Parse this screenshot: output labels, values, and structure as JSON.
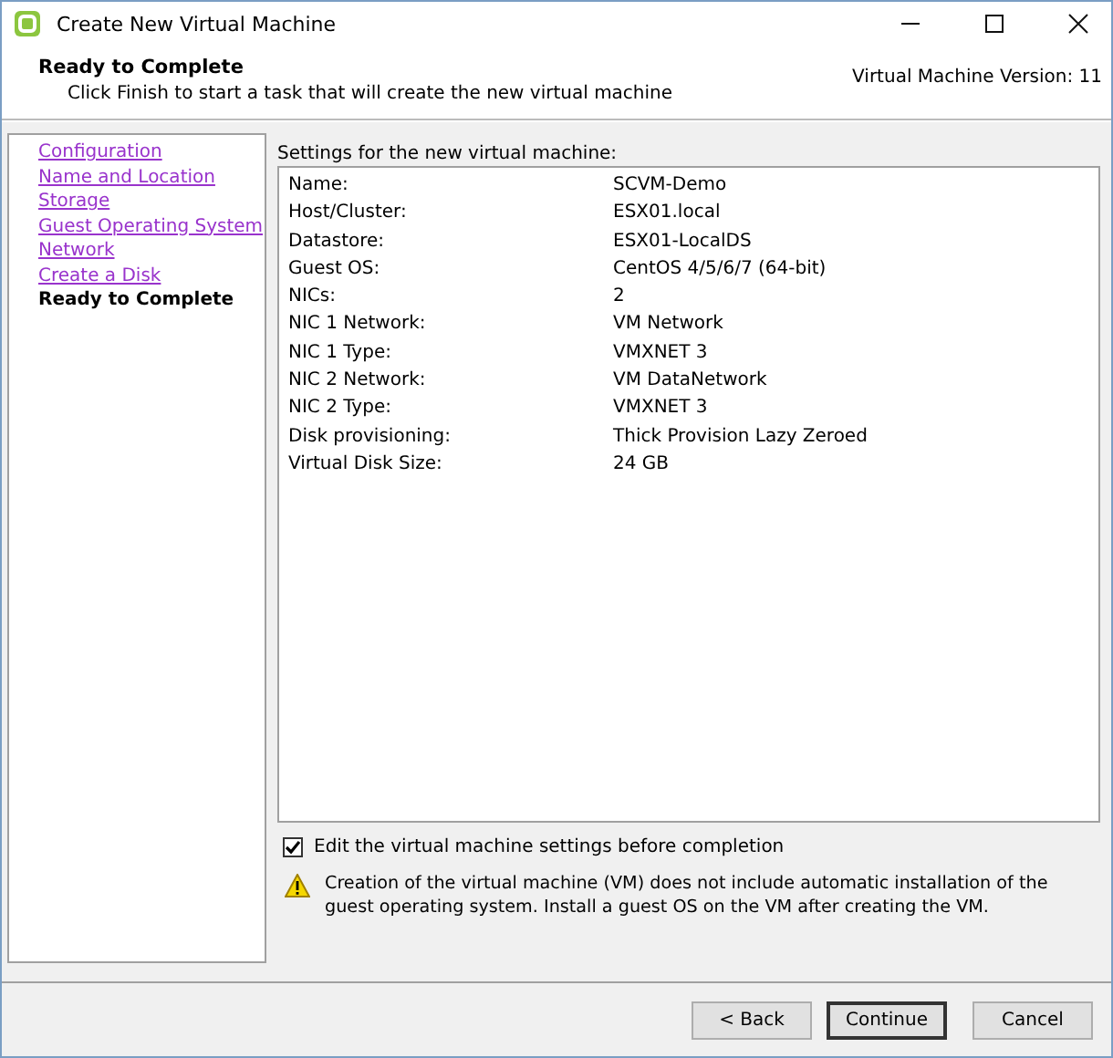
{
  "window": {
    "title": "Create New Virtual Machine"
  },
  "header": {
    "title": "Ready to Complete",
    "subtitle": "Click Finish to start a task that will create the new virtual machine",
    "version": "Virtual Machine Version: 11"
  },
  "steps": [
    {
      "label": "Configuration",
      "selected": false
    },
    {
      "label": "Name and Location",
      "selected": false
    },
    {
      "label": "Storage",
      "selected": false
    },
    {
      "label": "Guest Operating System",
      "selected": false
    },
    {
      "label": "Network",
      "selected": false
    },
    {
      "label": "Create a Disk",
      "selected": false
    },
    {
      "label": "Ready to Complete",
      "selected": true
    }
  ],
  "settings": {
    "title": "Settings for the new virtual machine:",
    "rows": [
      {
        "name": "Name:",
        "value": "SCVM-Demo"
      },
      {
        "name": "Host/Cluster:",
        "value": "ESX01.local"
      },
      {
        "name": "Datastore:",
        "value": "ESX01-LocalDS"
      },
      {
        "name": "Guest OS:",
        "value": "CentOS 4/5/6/7 (64-bit)"
      },
      {
        "name": "NICs:",
        "value": "2"
      },
      {
        "name": "NIC 1 Network:",
        "value": "VM Network"
      },
      {
        "name": "NIC 1 Type:",
        "value": "VMXNET 3"
      },
      {
        "name": "NIC 2 Network:",
        "value": "VM DataNetwork"
      },
      {
        "name": "NIC 2 Type:",
        "value": "VMXNET 3"
      },
      {
        "name": "Disk provisioning:",
        "value": "Thick Provision Lazy Zeroed"
      },
      {
        "name": "Virtual Disk Size:",
        "value": "24 GB"
      }
    ]
  },
  "edit_checkbox": {
    "label": "Edit the virtual machine settings before completion",
    "checked": true
  },
  "warning": "Creation of the virtual machine (VM) does not include automatic installation of the guest operating system. Install a guest OS on the VM after creating the VM.",
  "buttons": [
    {
      "label": "< Back",
      "default": false
    },
    {
      "label": "Continue",
      "default": true
    },
    {
      "label": "Cancel",
      "default": false
    }
  ]
}
